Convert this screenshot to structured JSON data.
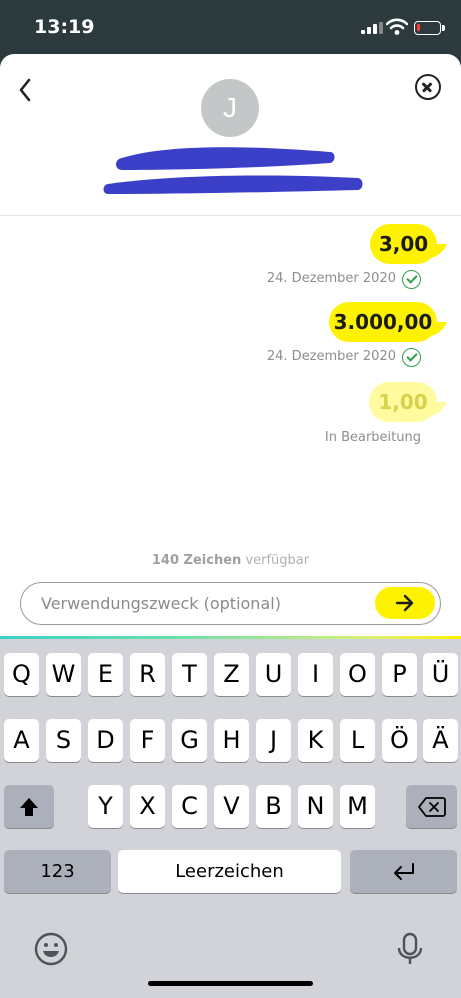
{
  "status_bar": {
    "time": "13:19",
    "battery_level": 0.12
  },
  "header": {
    "avatar_initial": "J"
  },
  "messages": [
    {
      "amount": "3,00",
      "meta": "24. Dezember 2020",
      "status": "confirmed"
    },
    {
      "amount": "3.000,00",
      "meta": "24. Dezember 2020",
      "status": "confirmed"
    },
    {
      "amount": "1,00",
      "meta": "In Bearbeitung",
      "status": "pending"
    }
  ],
  "composer": {
    "counter_value": "140 Zeichen",
    "counter_suffix": "verfügbar",
    "placeholder": "Verwendungszweck (optional)"
  },
  "keyboard": {
    "row1": [
      "Q",
      "W",
      "E",
      "R",
      "T",
      "Z",
      "U",
      "I",
      "O",
      "P",
      "Ü"
    ],
    "row2": [
      "A",
      "S",
      "D",
      "F",
      "G",
      "H",
      "J",
      "K",
      "L",
      "Ö",
      "Ä"
    ],
    "row3": [
      "Y",
      "X",
      "C",
      "V",
      "B",
      "N",
      "M"
    ],
    "numbers_label": "123",
    "space_label": "Leerzeichen"
  },
  "colors": {
    "accent": "#fff200",
    "pending": "#fffb9e",
    "confirmed": "#2f9e4b",
    "redaction": "#3c40c8"
  }
}
